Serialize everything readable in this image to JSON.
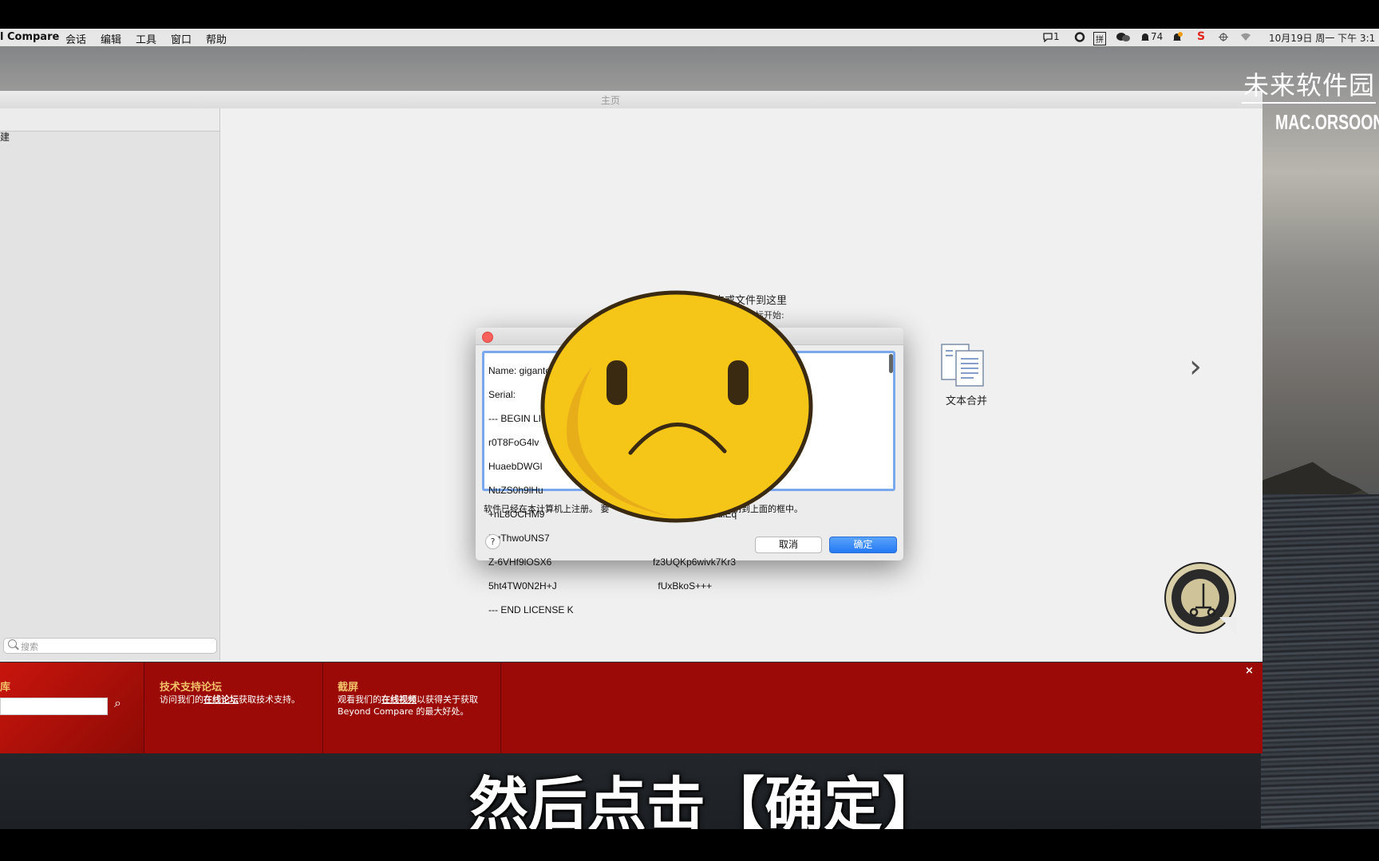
{
  "menubar": {
    "app_name": "l Compare",
    "items": [
      "会话",
      "编辑",
      "工具",
      "窗口",
      "帮助"
    ],
    "status": {
      "messages_count": "1",
      "input_method": "拼",
      "notification_count": "74",
      "datetime": "10月19日 周一 下午 3:1"
    }
  },
  "window": {
    "title": "主页",
    "sidebar": {
      "item": "建",
      "search_placeholder": "搜索"
    },
    "main": {
      "drop_text": "夹或文件到这里",
      "drop_sub": "图标开始:",
      "text_merge_label": "文本合并"
    }
  },
  "dialog": {
    "license_lines": [
      "Name: giganto",
      "Serial:",
      "--- BEGIN LI",
      "r0T8FoG4lv",
      "HuaebDWGl",
      "NuZS0h9lHu",
      "+nL8OCHM9                                          yLQihu87HOYuiEq",
      "RqThwoUNS7",
      "Z-6VHf9lOSX6                                      fz3UQKp6wivk7Kr3",
      "5ht4TW0N2H+J                                      fUxBkoS+++",
      "--- END LICENSE K"
    ],
    "message_left": "软件已经在本计算机上注册。",
    "message_mid": "要",
    "message_right": "钥到上面的框中。",
    "help_label": "?",
    "cancel_label": "取消",
    "ok_label": "确定"
  },
  "banner": {
    "library_title": "库",
    "forum_title": "技术支持论坛",
    "forum_text_1": "访问我们的",
    "forum_link": "在线论坛",
    "forum_text_2": "获取技术支持。",
    "screen_title": "截屏",
    "screen_text_1": "观看我们的",
    "screen_link": "在线视频",
    "screen_text_2": "以获得关于获取 Beyond Compare 的最大好处。",
    "close_label": "×"
  },
  "seal_text": "SCOOTER SOFTWARE SEAL QUALITY",
  "watermark": {
    "chinese": "未来软件园",
    "english": "MAC.ORSOON"
  },
  "subtitle": "然后点击【确定】",
  "colors": {
    "banner_red": "#9b0a06",
    "banner_title": "#f4c36b",
    "ok_blue": "#2479f3",
    "emoji_yellow": "#f5c518"
  }
}
